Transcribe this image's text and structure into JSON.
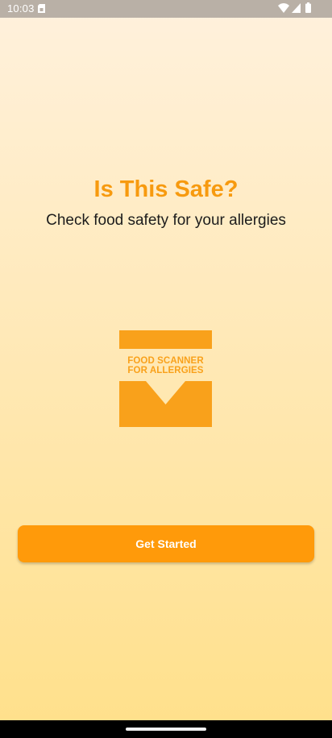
{
  "status_bar": {
    "time": "10:03",
    "icons": [
      "sim-card-icon",
      "wifi-icon",
      "signal-icon",
      "battery-icon"
    ]
  },
  "app": {
    "title": "Is This Safe?",
    "subtitle": "Check food safety for your allergies"
  },
  "logo": {
    "line1": "FOOD SCANNER",
    "line2": "FOR ALLERGIES"
  },
  "cta": {
    "label": "Get Started"
  },
  "colors": {
    "accent": "#ff9a0a",
    "logo_orange": "#f9a11b",
    "title_orange": "#f79a0f"
  }
}
